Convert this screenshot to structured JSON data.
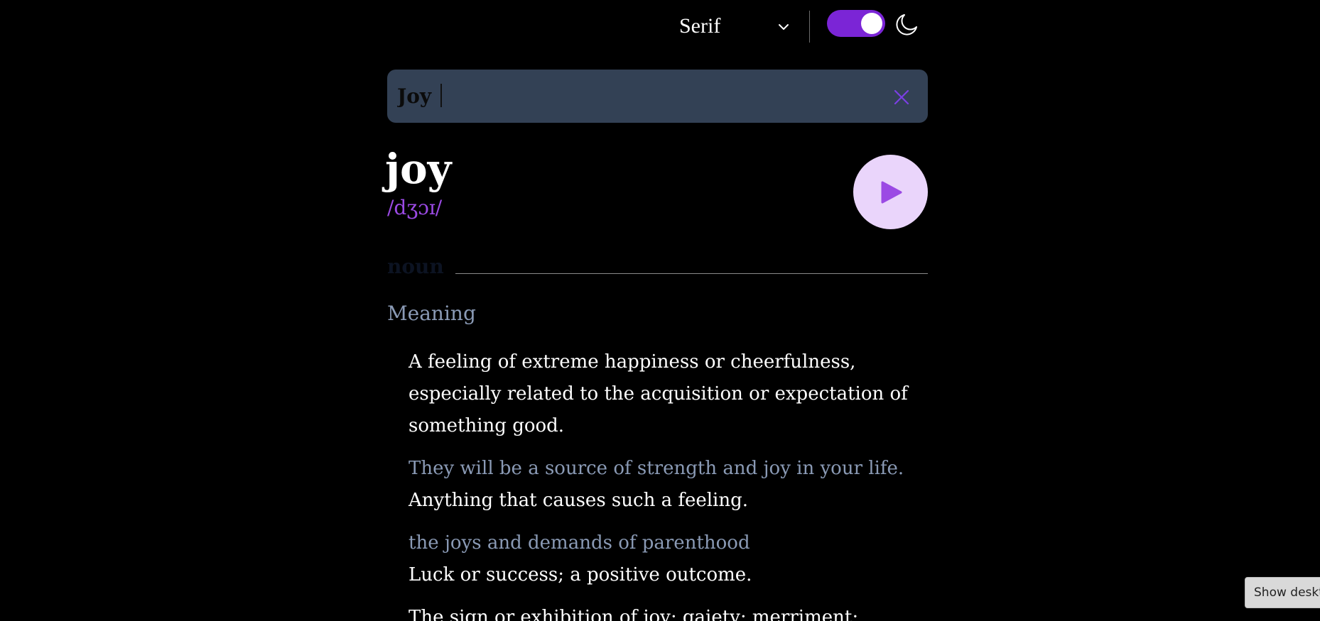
{
  "header": {
    "font_selector_label": "Serif",
    "icons": {
      "chevron": "chevron-down-icon",
      "moon": "moon-icon"
    },
    "theme_toggle_on": true,
    "accent_color": "#7b25d6"
  },
  "search": {
    "value": "Joy",
    "clear_icon": "close-icon"
  },
  "entry": {
    "word": "joy",
    "phonetic": "/dʒɔɪ/",
    "play_icon": "play-icon",
    "part_of_speech": "noun",
    "meaning_heading": "Meaning",
    "definitions": [
      {
        "text": "A feeling of extreme happiness or cheerfulness, especially related to the acquisition or expectation of something good.",
        "example": "They will be a source of strength and joy in your life."
      },
      {
        "text": "Anything that causes such a feeling.",
        "example": "the joys and demands of parenthood"
      },
      {
        "text": "Luck or success; a positive outcome.",
        "example": ""
      },
      {
        "text": "The sign or exhibition of joy; gaiety; merriment;",
        "example": ""
      }
    ]
  },
  "system": {
    "show_desktop_label": "Show desktop"
  }
}
